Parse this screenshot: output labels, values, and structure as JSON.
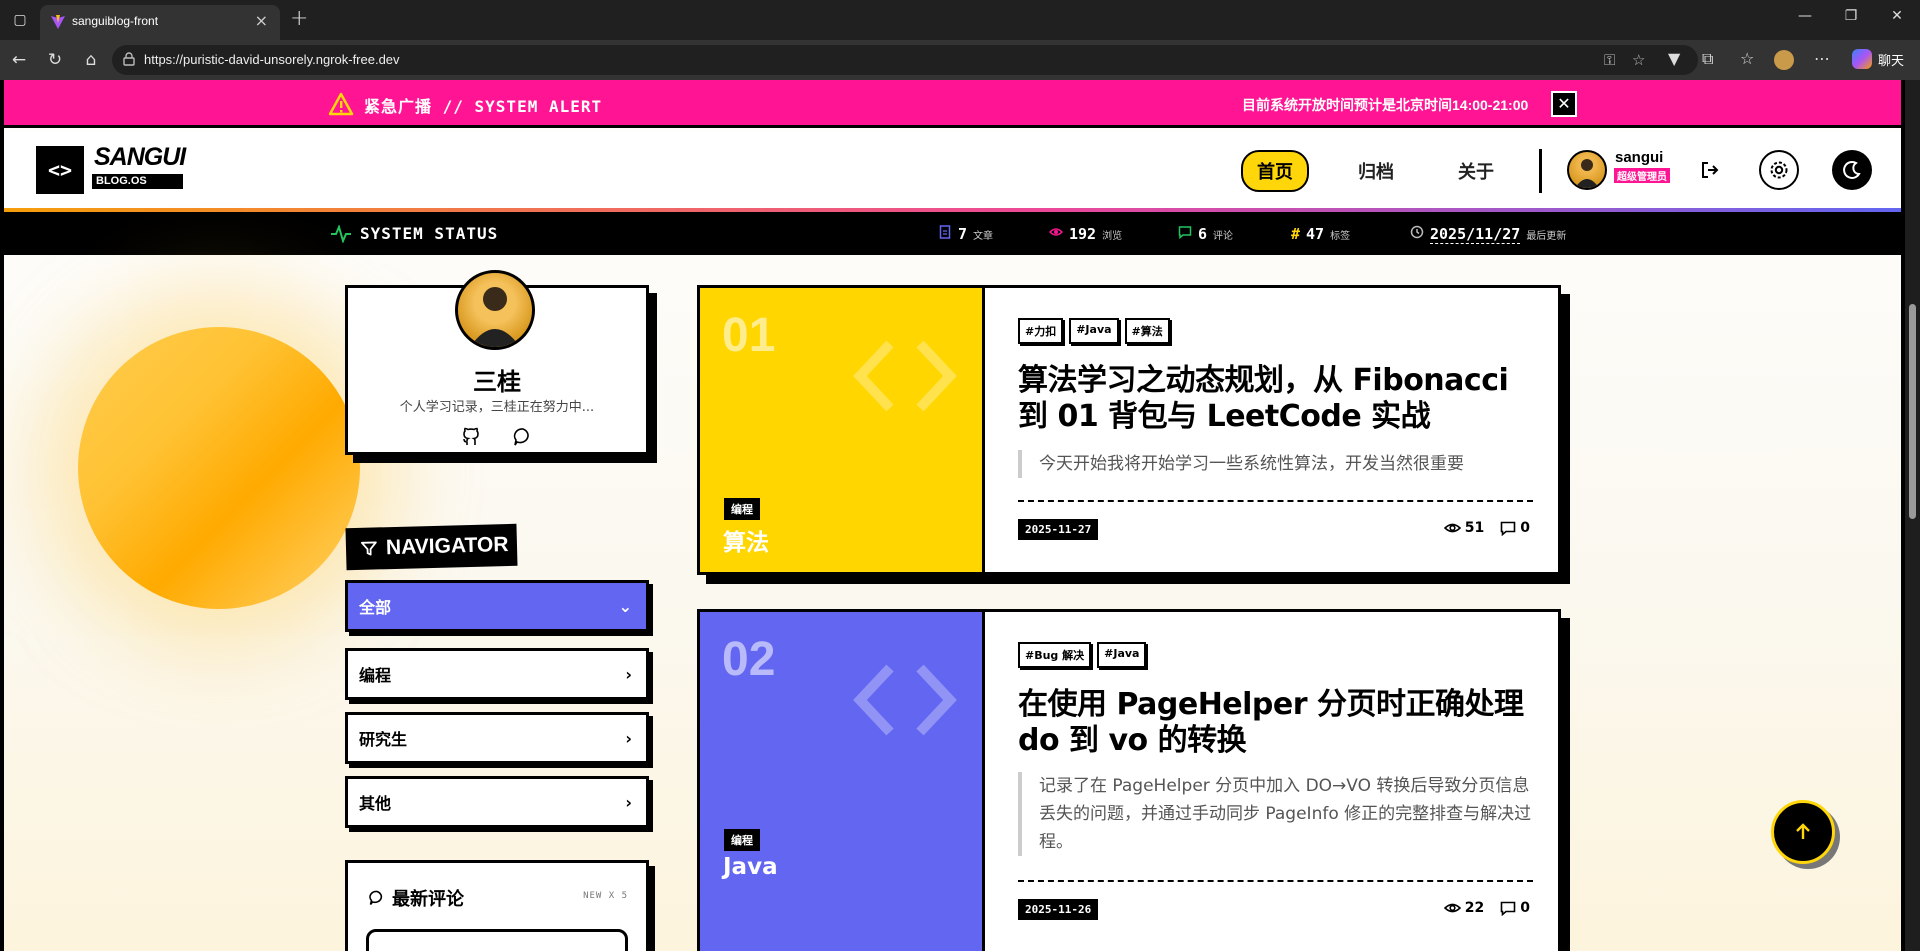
{
  "browser": {
    "tab_title": "sanguiblog-front",
    "url": "https://puristic-david-unsorely.ngrok-free.dev",
    "copilot_label": "聊天"
  },
  "alert": {
    "title": "紧急广播 // SYSTEM ALERT",
    "message": "目前系统开放时间预计是北京时间14:00-21:00",
    "close": "✕"
  },
  "header": {
    "logo_mark": "<>",
    "logo_name": "SANGUI",
    "logo_sub": "BLOG.OS",
    "nav": [
      {
        "label": "首页",
        "active": true
      },
      {
        "label": "归档",
        "active": false
      },
      {
        "label": "关于",
        "active": false
      }
    ],
    "user_name": "sangui",
    "user_role": "超级管理员"
  },
  "status": {
    "title": "SYSTEM STATUS",
    "stats": [
      {
        "icon": "file-icon",
        "value": "7",
        "label": "文章",
        "color": "#6366f1"
      },
      {
        "icon": "eye-icon",
        "value": "192",
        "label": "浏览",
        "color": "#ff1493"
      },
      {
        "icon": "comment-icon",
        "value": "6",
        "label": "评论",
        "color": "#22c55e"
      },
      {
        "icon": "hash-icon",
        "value": "47",
        "label": "标签",
        "color": "#ffd60a"
      },
      {
        "icon": "clock-icon",
        "value": "2025/11/27",
        "label": "最后更新",
        "color": "#bbbbbb"
      }
    ]
  },
  "profile": {
    "name": "三桂",
    "description": "个人学习记录，三桂正在努力中..."
  },
  "navigator": {
    "title": "NAVIGATOR",
    "items": [
      {
        "label": "全部",
        "active": true
      },
      {
        "label": "编程",
        "active": false
      },
      {
        "label": "研究生",
        "active": false
      },
      {
        "label": "其他",
        "active": false
      }
    ]
  },
  "comments": {
    "title": "最新评论",
    "subtitle": "NEW X 5"
  },
  "articles": [
    {
      "number": "01",
      "color": "#ffd600",
      "category_badge": "编程",
      "category_name": "算法",
      "tags": [
        "#力扣",
        "#Java",
        "#算法"
      ],
      "title": "算法学习之动态规划，从 Fibonacci 到 01 背包与 LeetCode 实战",
      "excerpt": "今天开始我将开始学习一些系统性算法，开发当然很重要",
      "date": "2025-11-27",
      "views": "51",
      "comments": "0"
    },
    {
      "number": "02",
      "color": "#6366f1",
      "category_badge": "编程",
      "category_name": "Java",
      "tags": [
        "#Bug 解决",
        "#Java"
      ],
      "title": "在使用 PageHelper 分页时正确处理 do 到 vo 的转换",
      "excerpt": "记录了在 PageHelper 分页中加入 DO→VO 转换后导致分页信息丢失的问题，并通过手动同步 PageInfo 修正的完整排查与解决过程。",
      "date": "2025-11-26",
      "views": "22",
      "comments": "0"
    }
  ]
}
